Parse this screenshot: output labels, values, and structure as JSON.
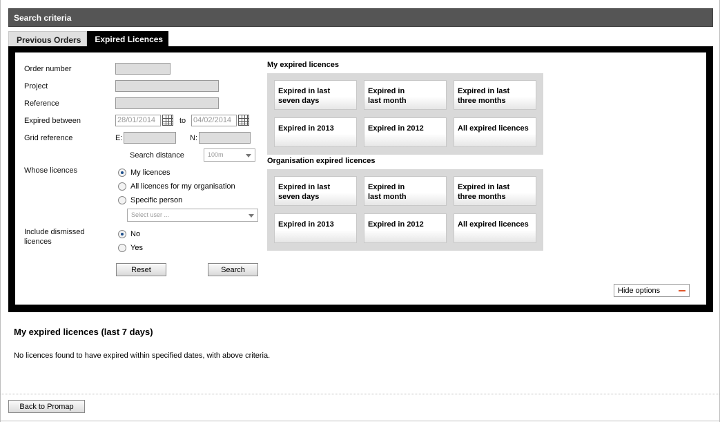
{
  "header": {
    "title": "Search criteria"
  },
  "tabs": [
    {
      "label": "Previous Orders",
      "active": false
    },
    {
      "label": "Expired Licences",
      "active": true
    }
  ],
  "form": {
    "order_number_label": "Order number",
    "project_label": "Project",
    "reference_label": "Reference",
    "expired_between_label": "Expired between",
    "date_from": "28/01/2014",
    "to_label": "to",
    "date_to": "04/02/2014",
    "grid_reference_label": "Grid reference",
    "easting_label": "E:",
    "northing_label": "N:",
    "search_distance_label": "Search distance",
    "search_distance_value": "100m",
    "whose_licences_label": "Whose licences",
    "whose_options": [
      "My licences",
      "All licences for my organisation",
      "Specific person"
    ],
    "whose_selected": "My licences",
    "select_user_placeholder": "Select user ...",
    "include_dismissed_label_1": "Include dismissed",
    "include_dismissed_label_2": "licences",
    "dismissed_options": [
      "No",
      "Yes"
    ],
    "dismissed_selected": "No",
    "reset_label": "Reset",
    "search_label": "Search"
  },
  "my_expired": {
    "title": "My expired licences",
    "buttons": [
      [
        "Expired in last",
        "seven days"
      ],
      [
        "Expired in",
        "last month"
      ],
      [
        "Expired in last",
        "three months"
      ],
      [
        "Expired in 2013",
        ""
      ],
      [
        "Expired in 2012",
        ""
      ],
      [
        "All expired licences",
        ""
      ]
    ]
  },
  "org_expired": {
    "title": "Organisation expired licences",
    "buttons": [
      [
        "Expired in last",
        "seven days"
      ],
      [
        "Expired in",
        "last month"
      ],
      [
        "Expired in last",
        "three months"
      ],
      [
        "Expired in 2013",
        ""
      ],
      [
        "Expired in 2012",
        ""
      ],
      [
        "All expired licences",
        ""
      ]
    ]
  },
  "hide_options_label": "Hide options",
  "results": {
    "title": "My expired licences (last 7 days)",
    "message": "No licences found to have expired within specified dates, with above criteria."
  },
  "footer": {
    "back_label": "Back to Promap"
  },
  "colors": {
    "header_bg": "#555555",
    "panel_bg": "#000000",
    "hide_minus": "#e0562b",
    "radio_dot": "#1d4f8c"
  }
}
